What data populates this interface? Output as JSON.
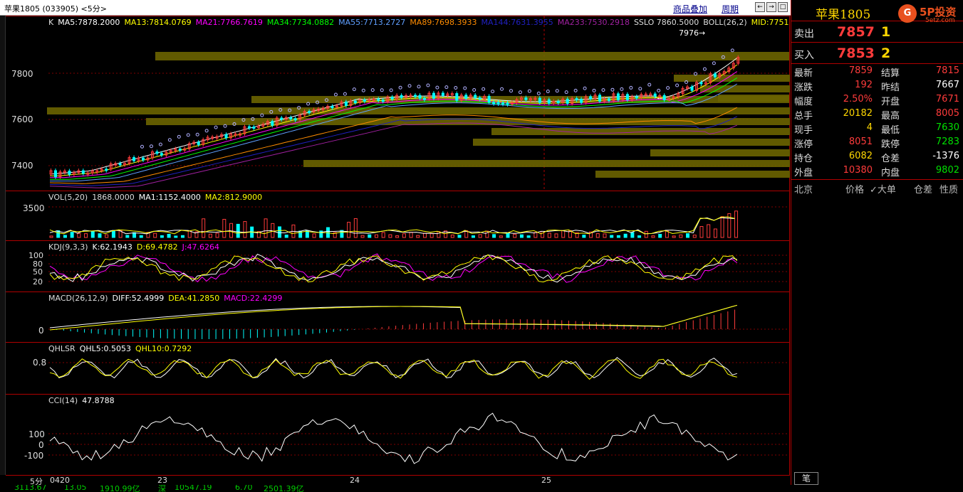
{
  "window": {
    "title": "苹果1805 (033905) <5分>",
    "links": [
      "商品叠加",
      "周期"
    ],
    "nav_buttons": [
      "←",
      "→",
      "□"
    ]
  },
  "panels": {
    "main": {
      "legend": [
        {
          "text": "K",
          "color": "#dddddd"
        },
        {
          "text": "MA5:7878.2000",
          "color": "#ffffff"
        },
        {
          "text": "MA13:7814.0769",
          "color": "#ffff00"
        },
        {
          "text": "MA21:7766.7619",
          "color": "#ff00ff"
        },
        {
          "text": "MA34:7734.0882",
          "color": "#00ff00"
        },
        {
          "text": "MA55:7713.2727",
          "color": "#5f9fff"
        },
        {
          "text": "MA89:7698.3933",
          "color": "#ff8c00"
        },
        {
          "text": "MA144:7631.3955",
          "color": "#2020c0"
        },
        {
          "text": "MA233:7530.2918",
          "color": "#a020a0"
        },
        {
          "text": "SSLO 7860.5000",
          "color": "#dddddd"
        },
        {
          "text": "BOLL(26,2)",
          "color": "#dddddd"
        },
        {
          "text": "MID:7751",
          "color": "#ffff00"
        }
      ],
      "yticks": [
        "7800",
        "7600",
        "7400"
      ],
      "high_marker": "7976"
    },
    "vol": {
      "legend": [
        {
          "text": "VOL(5,20)",
          "color": "#dddddd"
        },
        {
          "text": "1868.0000",
          "color": "#dddddd"
        },
        {
          "text": "MA1:1152.4000",
          "color": "#ffffff"
        },
        {
          "text": "MA2:812.9000",
          "color": "#ffff00"
        }
      ],
      "yticks": [
        "3500"
      ]
    },
    "kdj": {
      "legend": [
        {
          "text": "KDJ(9,3,3)",
          "color": "#dddddd"
        },
        {
          "text": "K:62.1943",
          "color": "#ffffff"
        },
        {
          "text": "D:69.4782",
          "color": "#ffff00"
        },
        {
          "text": "J:47.6264",
          "color": "#ff00ff"
        }
      ],
      "yticks": [
        "100",
        "80",
        "50",
        "20"
      ]
    },
    "macd": {
      "legend": [
        {
          "text": "MACD(26,12,9)",
          "color": "#dddddd"
        },
        {
          "text": "DIFF:52.4999",
          "color": "#ffffff"
        },
        {
          "text": "DEA:41.2850",
          "color": "#ffff00"
        },
        {
          "text": "MACD:22.4299",
          "color": "#ff00ff"
        }
      ],
      "yticks": [
        "0"
      ]
    },
    "qhl": {
      "legend": [
        {
          "text": "QHLSR",
          "color": "#dddddd"
        },
        {
          "text": "QHL5:0.5053",
          "color": "#ffffff"
        },
        {
          "text": "QHL10:0.7292",
          "color": "#ffff00"
        }
      ],
      "yticks": [
        "0.8"
      ]
    },
    "cci": {
      "legend": [
        {
          "text": "CCI(14)",
          "color": "#dddddd"
        },
        {
          "text": "47.8788",
          "color": "#ffffff"
        }
      ],
      "yticks": [
        "100",
        "0",
        "-100"
      ]
    }
  },
  "date_axis": {
    "period": "5分",
    "labels": [
      "0420",
      "23",
      "24",
      "25"
    ]
  },
  "quote": {
    "name": "苹果1805",
    "sell": {
      "label": "卖出",
      "price": "7857",
      "qty": "1"
    },
    "buy": {
      "label": "买入",
      "price": "7853",
      "qty": "2"
    },
    "rows": [
      {
        "l1": "最新",
        "v1": "7859",
        "c1": "#ff3b3b",
        "l2": "结算",
        "v2": "7815",
        "c2": "#ff3b3b"
      },
      {
        "l1": "涨跌",
        "v1": "192",
        "c1": "#ff3b3b",
        "l2": "昨结",
        "v2": "7667",
        "c2": "#ffffff"
      },
      {
        "l1": "幅度",
        "v1": "2.50%",
        "c1": "#ff3b3b",
        "l2": "开盘",
        "v2": "7671",
        "c2": "#ff3b3b"
      },
      {
        "l1": "总手",
        "v1": "20182",
        "c1": "#ffd700",
        "l2": "最高",
        "v2": "8005",
        "c2": "#ff3b3b"
      },
      {
        "l1": "现手",
        "v1": "4",
        "c1": "#ffd700",
        "l2": "最低",
        "v2": "7630",
        "c2": "#00e000"
      },
      {
        "l1": "涨停",
        "v1": "8051",
        "c1": "#ff3b3b",
        "l2": "跌停",
        "v2": "7283",
        "c2": "#00e000"
      },
      {
        "l1": "持仓",
        "v1": "6082",
        "c1": "#ffd700",
        "l2": "仓差",
        "v2": "-1376",
        "c2": "#ffffff"
      },
      {
        "l1": "外盘",
        "v1": "10380",
        "c1": "#ff3b3b",
        "l2": "内盘",
        "v2": "9802",
        "c2": "#00e000"
      }
    ],
    "columns": [
      "北京",
      "价格",
      "✓大单",
      "仓差",
      "性质"
    ],
    "tab": "笔"
  },
  "logo": {
    "glyph": "G",
    "name": "5P投资",
    "sub": "5etz.com"
  },
  "status_fragments": [
    "3113.67",
    "13.05",
    "1910.99亿",
    "深",
    "10547.19",
    "6.70",
    "2501.39亿"
  ],
  "colors": {
    "up": "#ff3b3b",
    "down": "#00ffff",
    "grid": "#b00000",
    "ma": "#ffff00"
  }
}
